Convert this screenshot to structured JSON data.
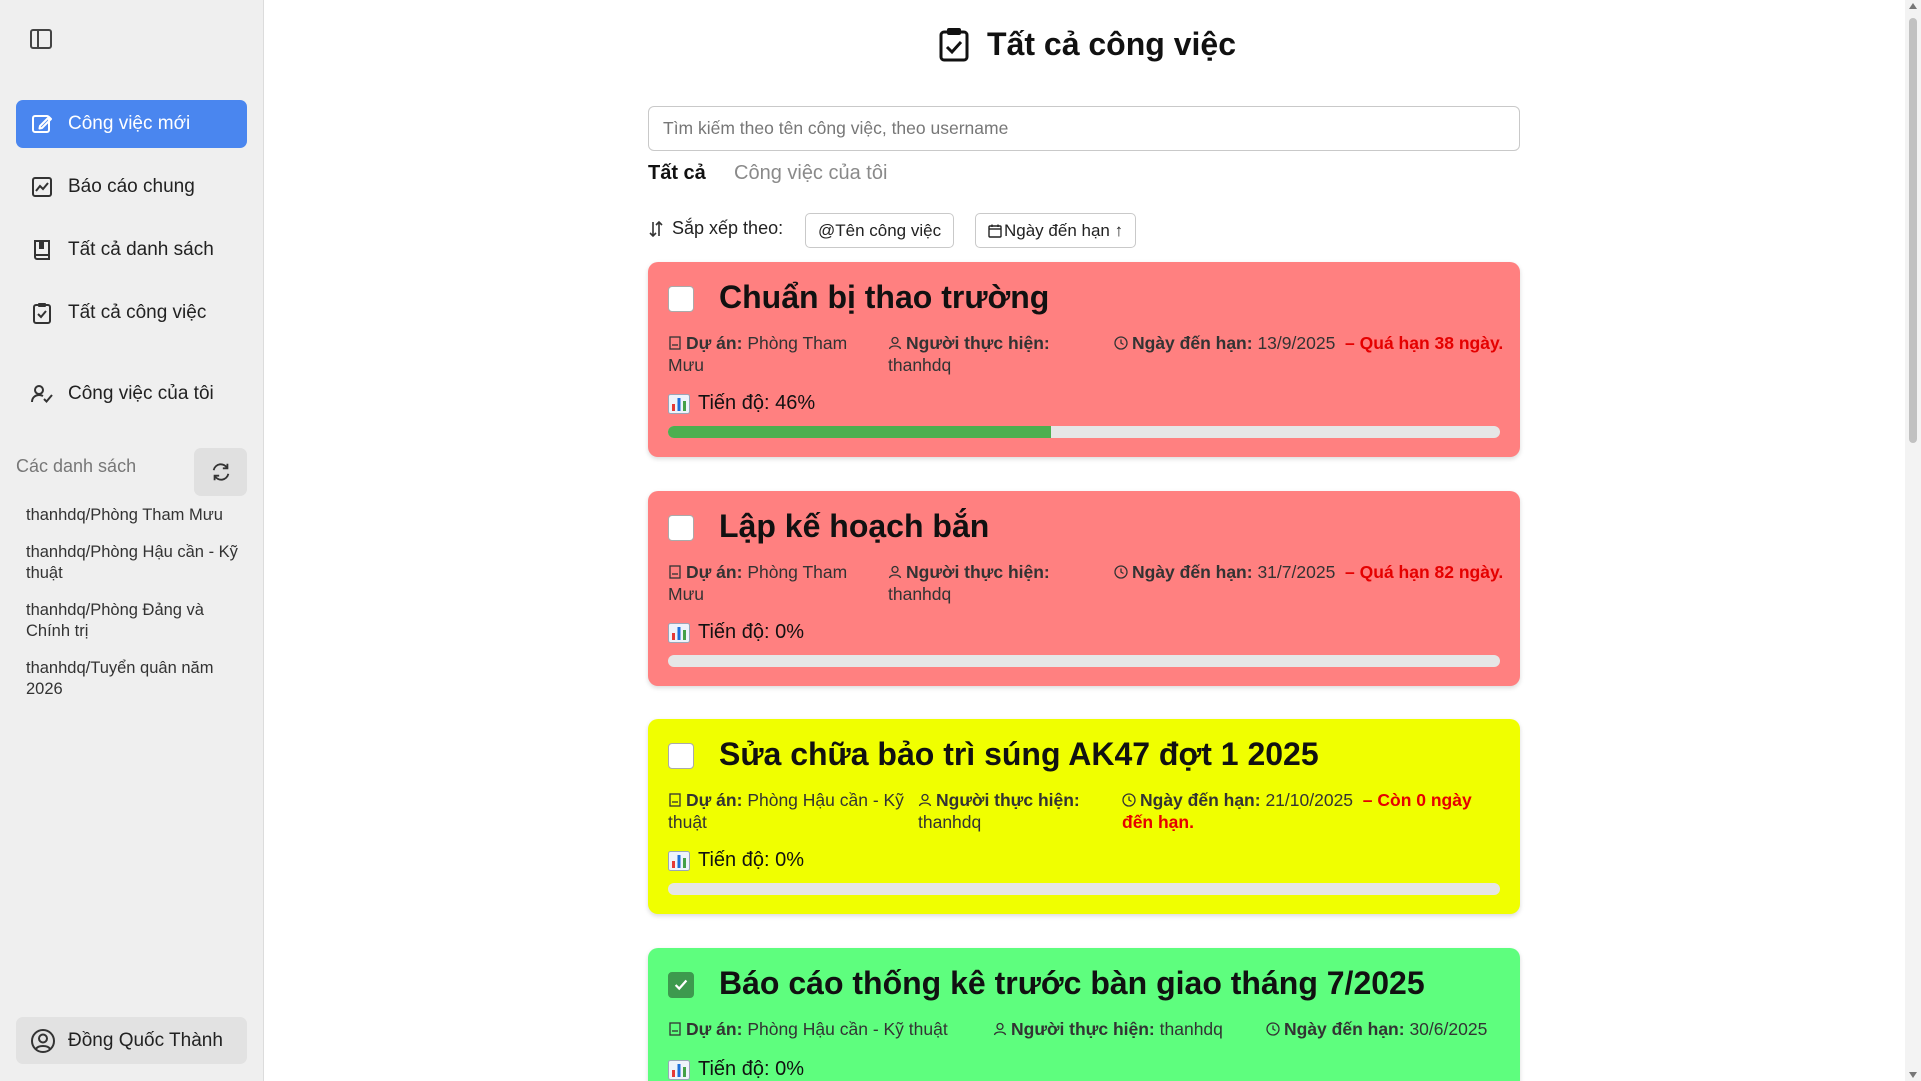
{
  "sidebar": {
    "toggle_icon": "sidebar-toggle-icon",
    "nav": [
      {
        "label": "Công việc mới",
        "icon": "edit-icon",
        "active": true
      },
      {
        "label": "Báo cáo chung",
        "icon": "chart-icon",
        "active": false
      },
      {
        "label": "Tất cả danh sách",
        "icon": "book-icon",
        "active": false
      },
      {
        "label": "Tất cả công việc",
        "icon": "clipboard-check-icon",
        "active": false
      },
      {
        "label": "Công việc của tôi",
        "icon": "user-check-icon",
        "active": false
      }
    ],
    "lists_label": "Các danh sách",
    "refresh_icon": "refresh-icon",
    "lists": [
      "thanhdq/Phòng Tham Mưu",
      "thanhdq/Phòng Hậu cần - Kỹ thuật",
      "thanhdq/Phòng Đảng và Chính trị",
      "thanhdq/Tuyển quân năm 2026"
    ],
    "user_name": "Đồng Quốc Thành"
  },
  "header": {
    "title": "Tất cả công việc"
  },
  "search": {
    "placeholder": "Tìm kiếm theo tên công việc, theo username",
    "value": ""
  },
  "tabs": {
    "all": "Tất cả",
    "mine": "Công việc của tôi"
  },
  "sort": {
    "label": "Sắp xếp theo:",
    "by_name": "@Tên công việc",
    "by_due": "Ngày đến hạn ↑"
  },
  "labels": {
    "project": "Dự án:",
    "assignee": "Người thực hiện:",
    "due": "Ngày đến hạn:"
  },
  "colors": {
    "active_nav": "#4a86ef",
    "overdue_card": "#ff8080",
    "due_today_card": "#f0ff00",
    "done_card": "#5efe7e",
    "progress_fill": "#4caf50",
    "warning_text": "#e50000"
  },
  "tasks": [
    {
      "title": "Chuẩn bị thao trường",
      "checked": false,
      "status_color": "red",
      "project": "Phòng Tham Mưu",
      "assignee": "thanhdq",
      "due": "13/9/2025",
      "warning": "– Quá hạn 38 ngày.",
      "progress_text": "Tiến độ: 46%",
      "progress": 0.46
    },
    {
      "title": "Lập kế hoạch bắn",
      "checked": false,
      "status_color": "red",
      "project": "Phòng Tham Mưu",
      "assignee": "thanhdq",
      "due": "31/7/2025",
      "warning": "– Quá hạn 82 ngày.",
      "progress_text": "Tiến độ: 0%",
      "progress": 0
    },
    {
      "title": "Sửa chữa bảo trì súng AK47 đợt 1 2025",
      "checked": false,
      "status_color": "yellow",
      "project": "Phòng Hậu cần - Kỹ thuật",
      "assignee": "thanhdq",
      "due": "21/10/2025",
      "warning": "– Còn 0 ngày đến hạn.",
      "progress_text": "Tiến độ: 0%",
      "progress": 0
    },
    {
      "title": "Báo cáo thống kê trước bàn giao tháng 7/2025",
      "checked": true,
      "status_color": "green",
      "project": "Phòng Hậu cần - Kỹ thuật",
      "assignee": "thanhdq",
      "due": "30/6/2025",
      "warning": "",
      "progress_text": "Tiến độ: 0%",
      "progress": 0
    }
  ]
}
